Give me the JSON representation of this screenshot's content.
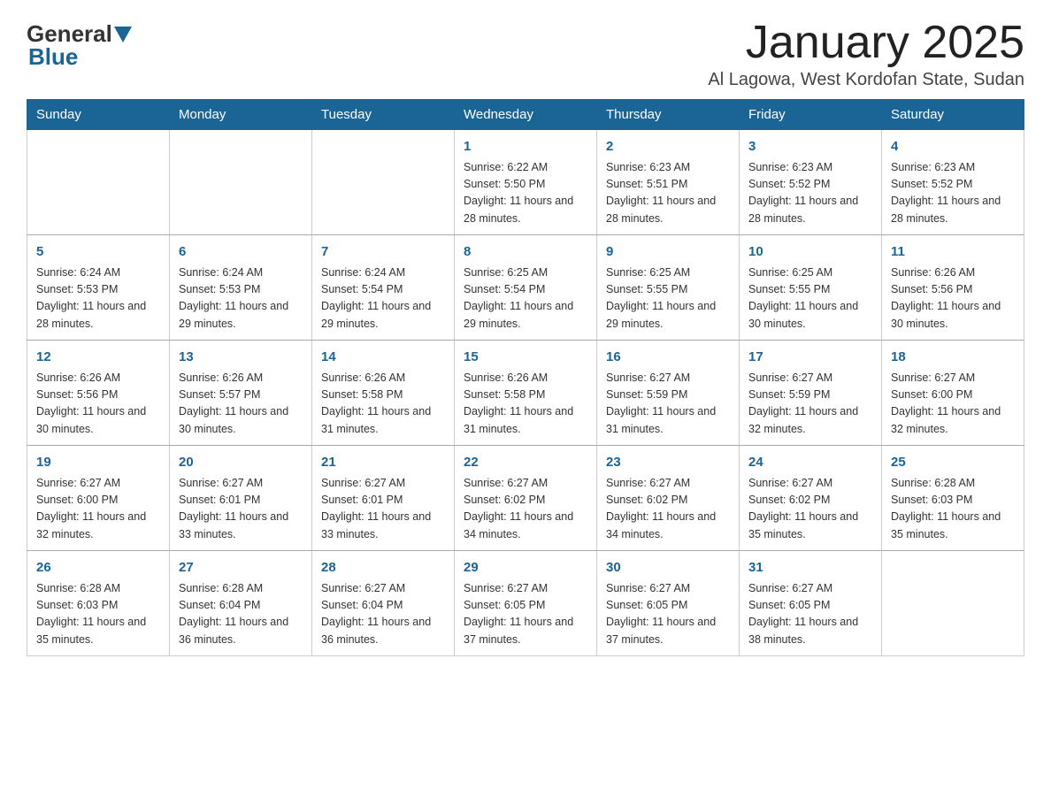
{
  "logo": {
    "general": "General",
    "blue": "Blue"
  },
  "title": "January 2025",
  "location": "Al Lagowa, West Kordofan State, Sudan",
  "days_of_week": [
    "Sunday",
    "Monday",
    "Tuesday",
    "Wednesday",
    "Thursday",
    "Friday",
    "Saturday"
  ],
  "weeks": [
    [
      {
        "day": "",
        "info": ""
      },
      {
        "day": "",
        "info": ""
      },
      {
        "day": "",
        "info": ""
      },
      {
        "day": "1",
        "info": "Sunrise: 6:22 AM\nSunset: 5:50 PM\nDaylight: 11 hours and 28 minutes."
      },
      {
        "day": "2",
        "info": "Sunrise: 6:23 AM\nSunset: 5:51 PM\nDaylight: 11 hours and 28 minutes."
      },
      {
        "day": "3",
        "info": "Sunrise: 6:23 AM\nSunset: 5:52 PM\nDaylight: 11 hours and 28 minutes."
      },
      {
        "day": "4",
        "info": "Sunrise: 6:23 AM\nSunset: 5:52 PM\nDaylight: 11 hours and 28 minutes."
      }
    ],
    [
      {
        "day": "5",
        "info": "Sunrise: 6:24 AM\nSunset: 5:53 PM\nDaylight: 11 hours and 28 minutes."
      },
      {
        "day": "6",
        "info": "Sunrise: 6:24 AM\nSunset: 5:53 PM\nDaylight: 11 hours and 29 minutes."
      },
      {
        "day": "7",
        "info": "Sunrise: 6:24 AM\nSunset: 5:54 PM\nDaylight: 11 hours and 29 minutes."
      },
      {
        "day": "8",
        "info": "Sunrise: 6:25 AM\nSunset: 5:54 PM\nDaylight: 11 hours and 29 minutes."
      },
      {
        "day": "9",
        "info": "Sunrise: 6:25 AM\nSunset: 5:55 PM\nDaylight: 11 hours and 29 minutes."
      },
      {
        "day": "10",
        "info": "Sunrise: 6:25 AM\nSunset: 5:55 PM\nDaylight: 11 hours and 30 minutes."
      },
      {
        "day": "11",
        "info": "Sunrise: 6:26 AM\nSunset: 5:56 PM\nDaylight: 11 hours and 30 minutes."
      }
    ],
    [
      {
        "day": "12",
        "info": "Sunrise: 6:26 AM\nSunset: 5:56 PM\nDaylight: 11 hours and 30 minutes."
      },
      {
        "day": "13",
        "info": "Sunrise: 6:26 AM\nSunset: 5:57 PM\nDaylight: 11 hours and 30 minutes."
      },
      {
        "day": "14",
        "info": "Sunrise: 6:26 AM\nSunset: 5:58 PM\nDaylight: 11 hours and 31 minutes."
      },
      {
        "day": "15",
        "info": "Sunrise: 6:26 AM\nSunset: 5:58 PM\nDaylight: 11 hours and 31 minutes."
      },
      {
        "day": "16",
        "info": "Sunrise: 6:27 AM\nSunset: 5:59 PM\nDaylight: 11 hours and 31 minutes."
      },
      {
        "day": "17",
        "info": "Sunrise: 6:27 AM\nSunset: 5:59 PM\nDaylight: 11 hours and 32 minutes."
      },
      {
        "day": "18",
        "info": "Sunrise: 6:27 AM\nSunset: 6:00 PM\nDaylight: 11 hours and 32 minutes."
      }
    ],
    [
      {
        "day": "19",
        "info": "Sunrise: 6:27 AM\nSunset: 6:00 PM\nDaylight: 11 hours and 32 minutes."
      },
      {
        "day": "20",
        "info": "Sunrise: 6:27 AM\nSunset: 6:01 PM\nDaylight: 11 hours and 33 minutes."
      },
      {
        "day": "21",
        "info": "Sunrise: 6:27 AM\nSunset: 6:01 PM\nDaylight: 11 hours and 33 minutes."
      },
      {
        "day": "22",
        "info": "Sunrise: 6:27 AM\nSunset: 6:02 PM\nDaylight: 11 hours and 34 minutes."
      },
      {
        "day": "23",
        "info": "Sunrise: 6:27 AM\nSunset: 6:02 PM\nDaylight: 11 hours and 34 minutes."
      },
      {
        "day": "24",
        "info": "Sunrise: 6:27 AM\nSunset: 6:02 PM\nDaylight: 11 hours and 35 minutes."
      },
      {
        "day": "25",
        "info": "Sunrise: 6:28 AM\nSunset: 6:03 PM\nDaylight: 11 hours and 35 minutes."
      }
    ],
    [
      {
        "day": "26",
        "info": "Sunrise: 6:28 AM\nSunset: 6:03 PM\nDaylight: 11 hours and 35 minutes."
      },
      {
        "day": "27",
        "info": "Sunrise: 6:28 AM\nSunset: 6:04 PM\nDaylight: 11 hours and 36 minutes."
      },
      {
        "day": "28",
        "info": "Sunrise: 6:27 AM\nSunset: 6:04 PM\nDaylight: 11 hours and 36 minutes."
      },
      {
        "day": "29",
        "info": "Sunrise: 6:27 AM\nSunset: 6:05 PM\nDaylight: 11 hours and 37 minutes."
      },
      {
        "day": "30",
        "info": "Sunrise: 6:27 AM\nSunset: 6:05 PM\nDaylight: 11 hours and 37 minutes."
      },
      {
        "day": "31",
        "info": "Sunrise: 6:27 AM\nSunset: 6:05 PM\nDaylight: 11 hours and 38 minutes."
      },
      {
        "day": "",
        "info": ""
      }
    ]
  ]
}
